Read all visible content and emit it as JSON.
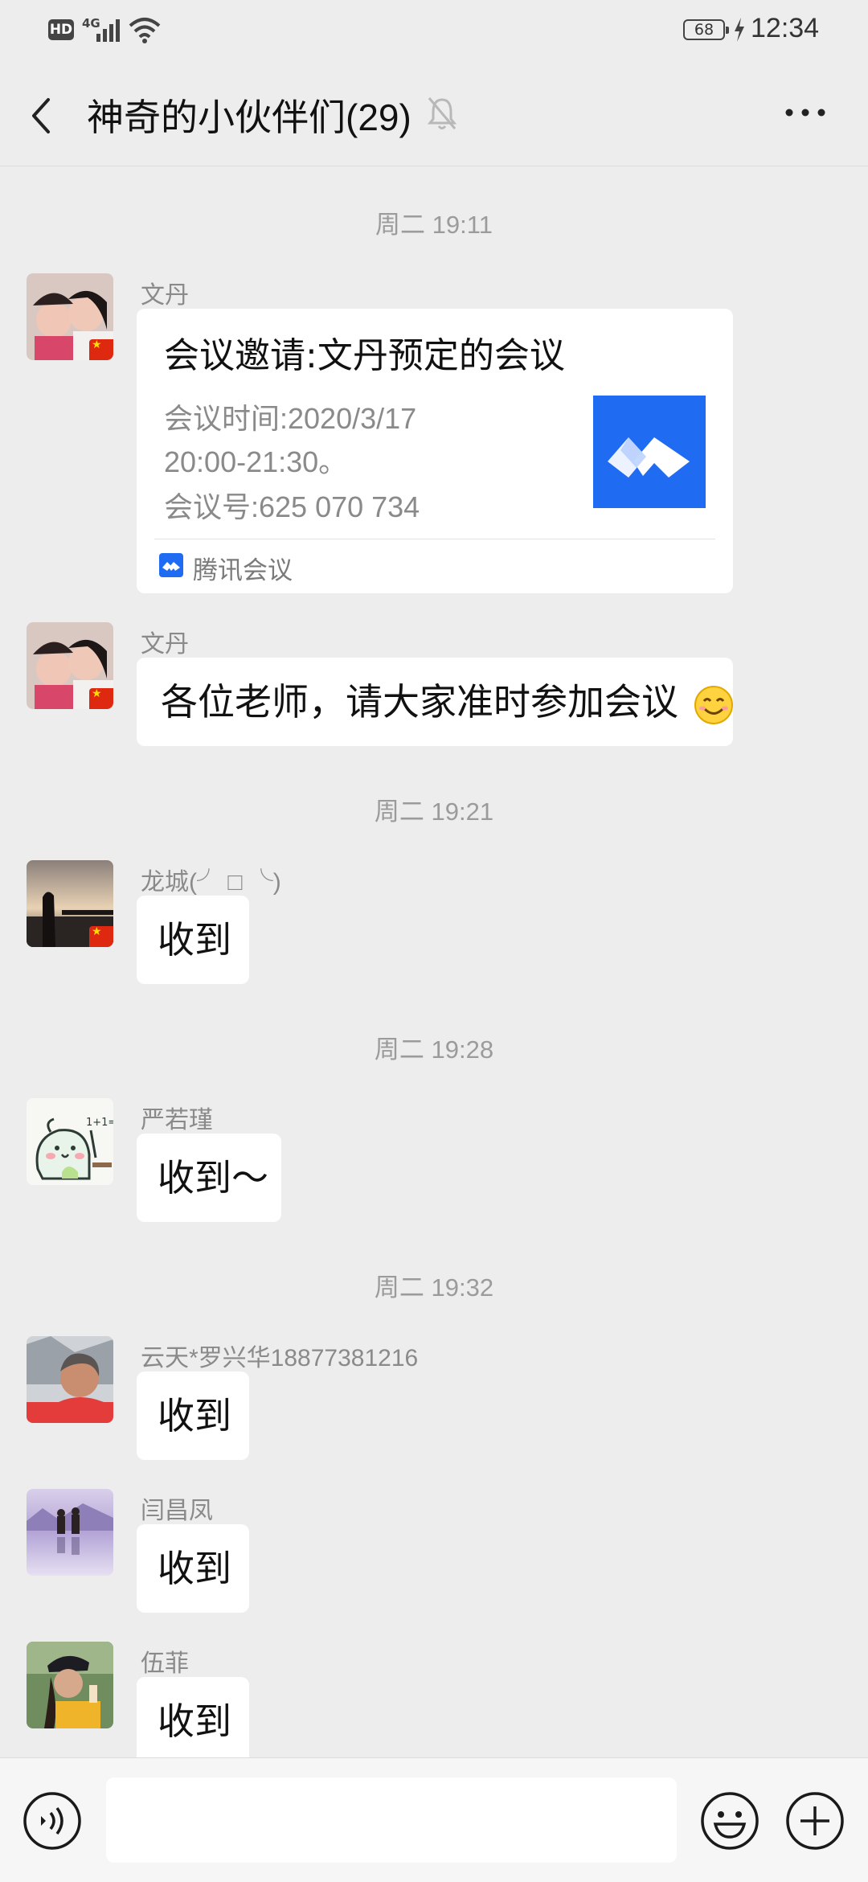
{
  "status_bar": {
    "hd": "HD",
    "network": "4G",
    "battery": "68",
    "time": "12:34"
  },
  "nav": {
    "title": "神奇的小伙伴们(29)"
  },
  "messages": {
    "ts1": "周二 19:11",
    "m1_sender": "文丹",
    "card_title": "会议邀请:文丹预定的会议",
    "card_line1": "会议时间:2020/3/17",
    "card_line2": "20:00-21:30。",
    "card_line3": "会议号:625 070 734",
    "card_app": "腾讯会议",
    "m2_sender": "文丹",
    "m2_text": "各位老师，请大家准时参加会议",
    "ts2": "周二 19:21",
    "m3_sender": "龙城(╯ □ ╰)",
    "m3_text": "收到",
    "ts3": "周二 19:28",
    "m4_sender": "严若瑾",
    "m4_text": "收到～",
    "ts4": "周二 19:32",
    "m5_sender": "云天*罗兴华18877381216",
    "m5_text": "收到",
    "m6_sender": "闫昌凤",
    "m6_text": "收到",
    "m7_sender": "伍菲",
    "m7_text": "收到"
  },
  "colors": {
    "background": "#ededed",
    "bubble": "#ffffff",
    "accent_blue": "#1f6cf2"
  }
}
